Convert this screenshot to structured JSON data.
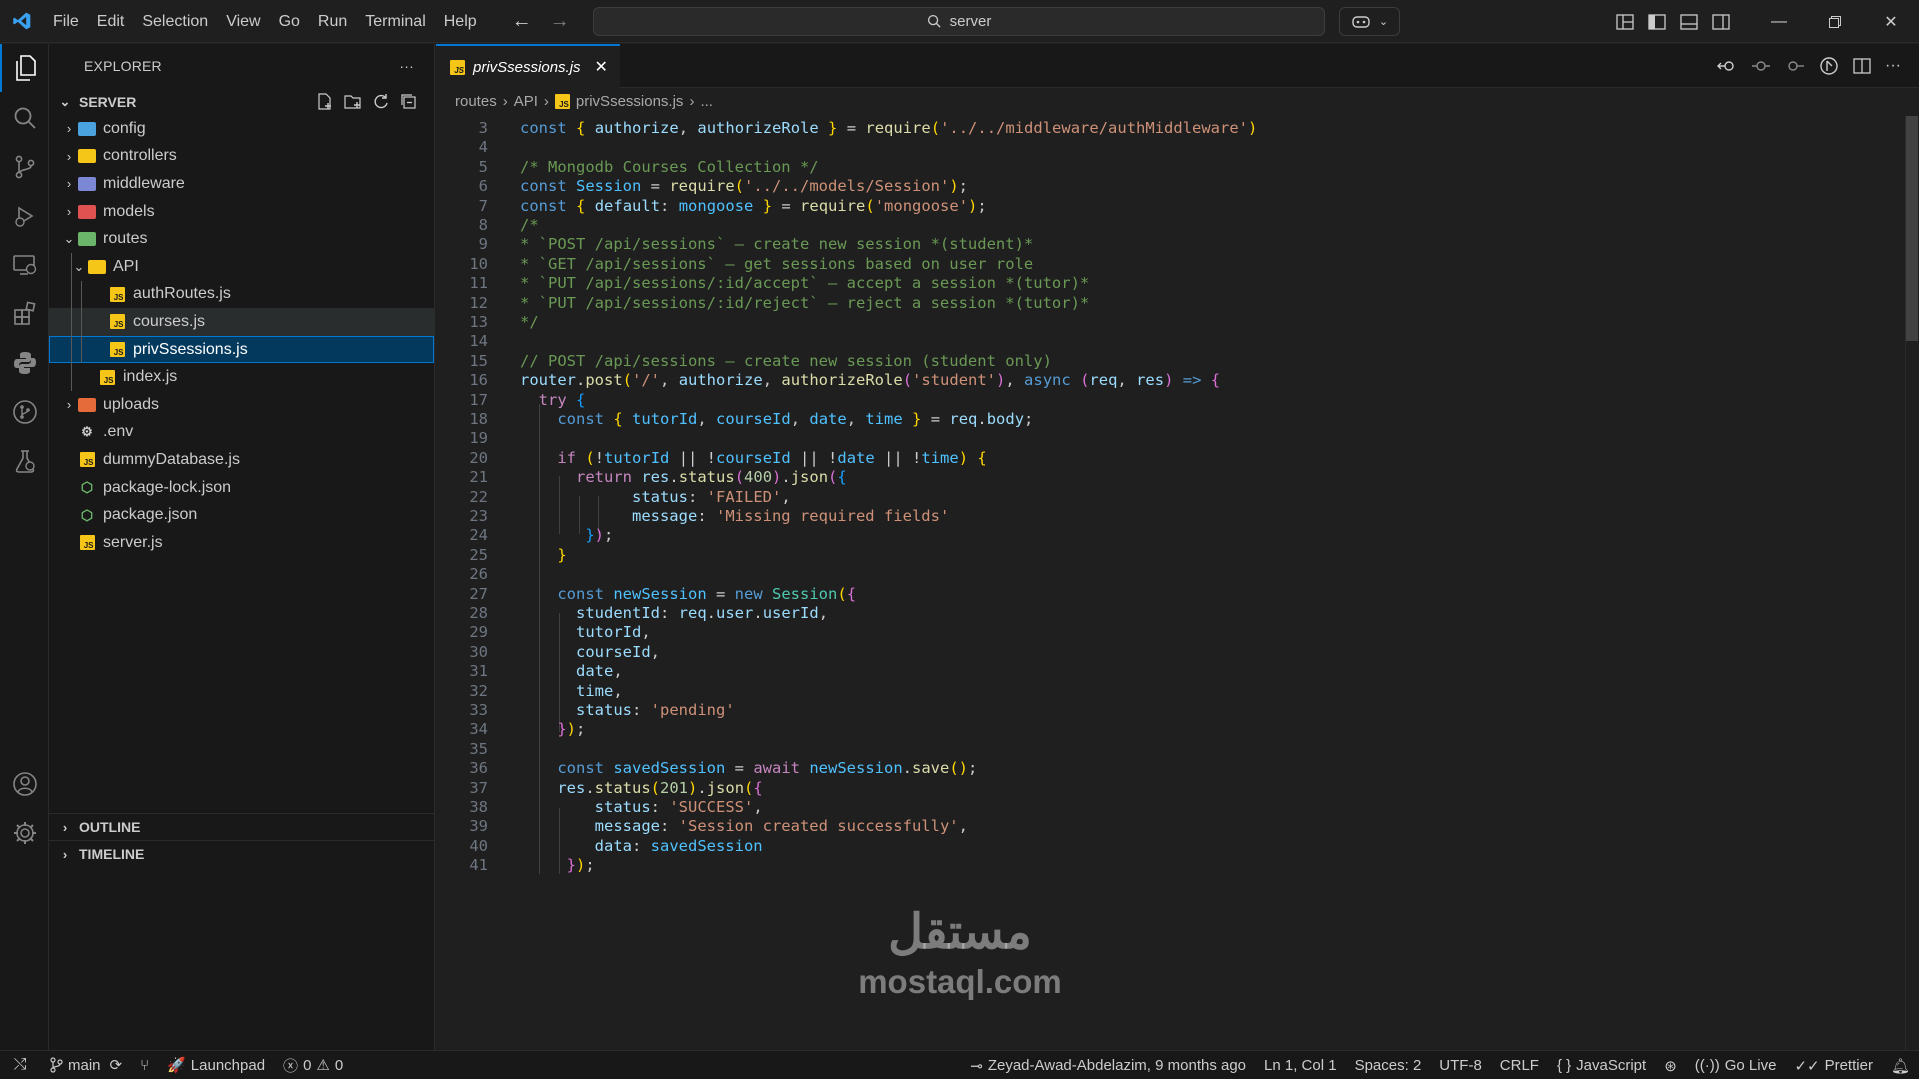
{
  "titlebar": {
    "menu": [
      "File",
      "Edit",
      "Selection",
      "View",
      "Go",
      "Run",
      "Terminal",
      "Help"
    ],
    "search_text": "server"
  },
  "sidebar": {
    "title": "EXPLORER",
    "more": "···",
    "section_title": "SERVER",
    "tree": [
      {
        "label": "config",
        "kind": "folder",
        "color": "#4aa3df"
      },
      {
        "label": "controllers",
        "kind": "folder",
        "color": "#f5c518"
      },
      {
        "label": "middleware",
        "kind": "folder",
        "color": "#7c87d6"
      },
      {
        "label": "models",
        "kind": "folder",
        "color": "#e05252"
      },
      {
        "label": "routes",
        "kind": "folder-open",
        "color": "#6bb56b"
      },
      {
        "label": "API",
        "kind": "folder-open",
        "color": "#f5c518"
      },
      {
        "label": "authRoutes.js",
        "kind": "js"
      },
      {
        "label": "courses.js",
        "kind": "js"
      },
      {
        "label": "privSsessions.js",
        "kind": "js"
      },
      {
        "label": "index.js",
        "kind": "js"
      },
      {
        "label": "uploads",
        "kind": "folder",
        "color": "#e56b3b"
      },
      {
        "label": ".env",
        "kind": "env"
      },
      {
        "label": "dummyDatabase.js",
        "kind": "js"
      },
      {
        "label": "package-lock.json",
        "kind": "npm"
      },
      {
        "label": "package.json",
        "kind": "npm"
      },
      {
        "label": "server.js",
        "kind": "js"
      }
    ],
    "outline": "OUTLINE",
    "timeline": "TIMELINE"
  },
  "editor": {
    "tab_label": "privSsessions.js",
    "breadcrumb": [
      "routes",
      "API",
      "privSsessions.js",
      "..."
    ],
    "line_numbers": [
      "3",
      "4",
      "5",
      "6",
      "7",
      "8",
      "9",
      "10",
      "11",
      "12",
      "13",
      "14",
      "15",
      "16",
      "17",
      "18",
      "19",
      "20",
      "21",
      "22",
      "23",
      "24",
      "25",
      "26",
      "27",
      "28",
      "29",
      "30",
      "31",
      "32",
      "33",
      "34",
      "35",
      "36",
      "37",
      "38",
      "39",
      "40",
      "41"
    ]
  },
  "watermark": {
    "arabic": "مستقل",
    "latin": "mostaql.com"
  },
  "statusbar": {
    "branch": "main",
    "launchpad": "Launchpad",
    "errors": "0",
    "warnings": "0",
    "blame": "Zeyad-Awad-Abdelazim, 9 months ago",
    "position": "Ln 1, Col 1",
    "spaces": "Spaces: 2",
    "encoding": "UTF-8",
    "eol": "CRLF",
    "language": "JavaScript",
    "golive": "Go Live",
    "prettier": "Prettier"
  }
}
